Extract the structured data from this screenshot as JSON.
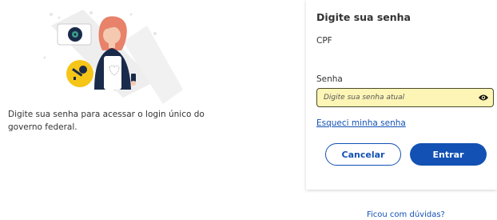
{
  "intro": {
    "text": "Digite sua senha para acessar o login único do governo federal."
  },
  "card": {
    "title": "Digite sua senha",
    "cpf_label": "CPF",
    "password_label": "Senha",
    "password_placeholder": "Digite sua senha atual",
    "password_value": "",
    "forgot_link": "Esqueci minha senha",
    "cancel_button": "Cancelar",
    "enter_button": "Entrar"
  },
  "footer": {
    "help_link": "Ficou com dúvidas?"
  },
  "icons": {
    "show_password": "eye-icon",
    "key": "key-icon",
    "safe": "safe-icon"
  },
  "colors": {
    "primary": "#1351b4",
    "field_focus_bg": "#fdf5b6",
    "key_badge": "#f5c518",
    "hair": "#e8826a"
  }
}
